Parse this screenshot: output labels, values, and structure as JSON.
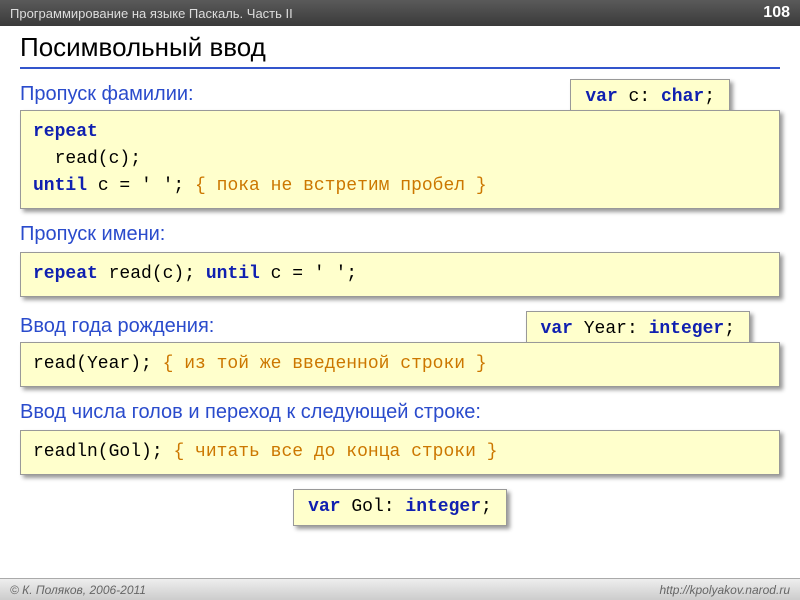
{
  "header": {
    "title": "Программирование на языке Паскаль. Часть II",
    "page": "108"
  },
  "title": "Посимвольный ввод",
  "section1": {
    "label": "Пропуск фамилии:",
    "var_decl_pre": "var",
    "var_decl_name": " c: ",
    "var_decl_type": "char",
    "var_decl_end": ";",
    "code_kw1": "repeat",
    "code_line2": "  read(c);",
    "code_kw2": "until",
    "code_cond": " c = ' '; ",
    "code_comment": "{ пока не встретим пробел }"
  },
  "section2": {
    "label": "Пропуск имени:",
    "kw1": "repeat",
    "mid": " read(c); ",
    "kw2": "until",
    "cond": " c = ' ';"
  },
  "section3": {
    "label": "Ввод года рождения:",
    "var_decl_pre": "var",
    "var_decl_name": " Year: ",
    "var_decl_type": "integer",
    "var_decl_end": ";",
    "code_call": "read(Year); ",
    "code_comment": "{ из той же введенной строки }"
  },
  "section4": {
    "label": "Ввод числа голов и переход к следующей строке:",
    "code_call": "readln(Gol); ",
    "code_comment": "{ читать все до конца строки }",
    "var_decl_pre": "var",
    "var_decl_name": " Gol: ",
    "var_decl_type": "integer",
    "var_decl_end": ";"
  },
  "footer": {
    "left": "© К. Поляков, 2006-2011",
    "right": "http://kpolyakov.narod.ru"
  }
}
